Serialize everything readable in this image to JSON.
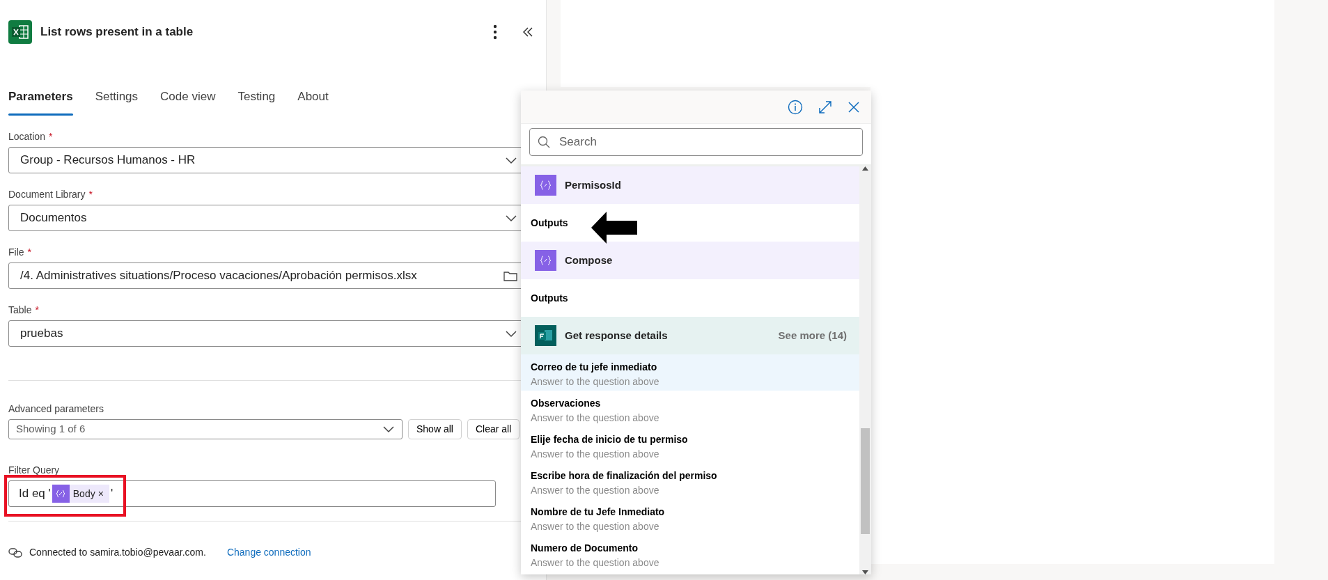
{
  "panel": {
    "title": "List rows present in a table",
    "tabs": [
      {
        "label": "Parameters",
        "selected": true
      },
      {
        "label": "Settings",
        "selected": false
      },
      {
        "label": "Code view",
        "selected": false
      },
      {
        "label": "Testing",
        "selected": false
      },
      {
        "label": "About",
        "selected": false
      }
    ],
    "fields": [
      {
        "kind": "dropdown",
        "label": "Location",
        "required_mark": "*",
        "value": "Group - Recursos Humanos - HR"
      },
      {
        "kind": "dropdown",
        "label": "Document Library",
        "required_mark": "*",
        "value": "Documentos"
      },
      {
        "kind": "file",
        "label": "File",
        "required_mark": "*",
        "value": "/4. Administratives situations/Proceso vacaciones/Aprobación permisos.xlsx"
      },
      {
        "kind": "dropdown",
        "label": "Table",
        "required_mark": "*",
        "value": "pruebas"
      }
    ],
    "advanced_parameters": {
      "label": "Advanced parameters",
      "value": "Showing 1 of 6",
      "buttons": [
        "Show all",
        "Clear all"
      ]
    },
    "filter_query": {
      "label": "Filter Query",
      "text_before": "Id eq '",
      "token": "Body",
      "token_remove": "×",
      "text_after": "'",
      "highlighted": true
    },
    "connection": {
      "text": "Connected to samira.tobio@pevaar.com.",
      "link": "Change connection"
    }
  },
  "dynamic_content": {
    "search": {
      "placeholder": "Search"
    },
    "items": [
      {
        "kind": "variable_action",
        "label": "PermisosId"
      },
      {
        "kind": "output",
        "label": "Outputs"
      },
      {
        "kind": "variable_action",
        "label": "Compose"
      },
      {
        "kind": "output",
        "label": "Outputs"
      },
      {
        "kind": "forms_action",
        "label": "Get response details",
        "more": "See more (14)"
      },
      {
        "kind": "field",
        "label": "Correo de tu jefe inmediato",
        "description": "Answer to the question above",
        "selected": true
      },
      {
        "kind": "field",
        "label": "Observaciones",
        "description": "Answer to the question above",
        "selected": false
      },
      {
        "kind": "field",
        "label": "Elije fecha de inicio de tu permiso",
        "description": "Answer to the question above",
        "selected": false
      },
      {
        "kind": "field",
        "label": "Escribe hora de finalización del permiso",
        "description": "Answer to the question above",
        "selected": false
      },
      {
        "kind": "field",
        "label": "Nombre de tu Jefe Inmediato",
        "description": "Answer to the question above",
        "selected": false
      },
      {
        "kind": "field",
        "label": "Numero de Documento",
        "description": "Answer to the question above",
        "selected": false
      }
    ]
  }
}
